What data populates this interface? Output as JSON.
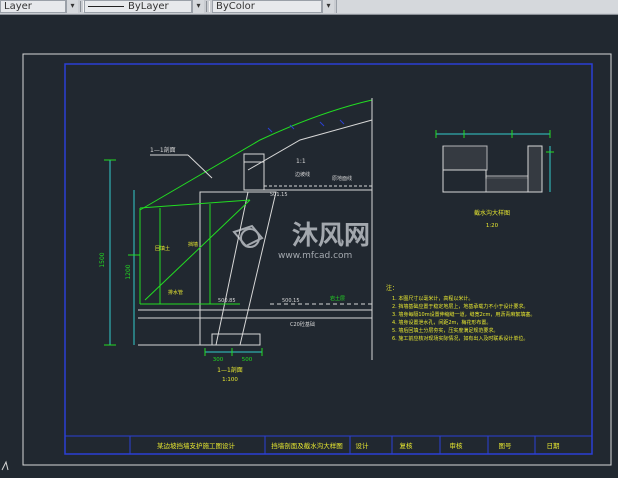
{
  "toolbar": {
    "layer_label": "Layer",
    "linetype_label": "ByLayer",
    "color_label": "ByColor",
    "dropdown_glyph": "▾"
  },
  "drawing": {
    "section_title_label": "1—1剖面",
    "dim_1500": "1500",
    "dim_1200": "1200",
    "dim_500": "500",
    "dim_300": "300",
    "slope_label": "1:1",
    "scale_100": "1:100",
    "detail_title": "截水沟大样图",
    "scale_20": "1:20",
    "elev_1": "500.85",
    "elev_2": "500.15",
    "elev_3": "501.15",
    "label_fill": "回填土",
    "label_ground": "原地面线",
    "label_base": "C20砼基础",
    "label_wall": "挡墙",
    "label_drain": "排水管",
    "label_slope": "边坡线",
    "label_rock": "岩土层",
    "notes_title": "注：",
    "notes": [
      "1. 本图尺寸以毫米计，高程以米计。",
      "2. 挡墙基础应置于稳定地层上，地基承载力不小于设计要求。",
      "3. 墙身每隔10m设置伸缩缝一道，缝宽2cm，用沥青麻絮填塞。",
      "4. 墙身设置泄水孔，间距2m，梅花形布置。",
      "5. 墙后回填土分层夯实，压实度满足规范要求。",
      "6. 施工前应核对现场实际情况，如有出入及时联系设计单位。"
    ],
    "watermark_main": "沐风网",
    "watermark_url": "www.mfcad.com",
    "title_block": {
      "project": "某边坡挡墙支护施工图设计",
      "drawing_name": "挡墙剖面及截水沟大样图",
      "designer": "设计",
      "checker": "复核",
      "reviewer": "审核",
      "drawing_no": "图号",
      "date": "日期"
    }
  },
  "colors": {
    "model_bg": "#212830",
    "frame_blue": "#2b3fd6",
    "frame_white": "#d8d8d8",
    "cad_green": "#22dd22",
    "cad_yellow": "#e8e830",
    "cad_cyan": "#33cccc"
  }
}
